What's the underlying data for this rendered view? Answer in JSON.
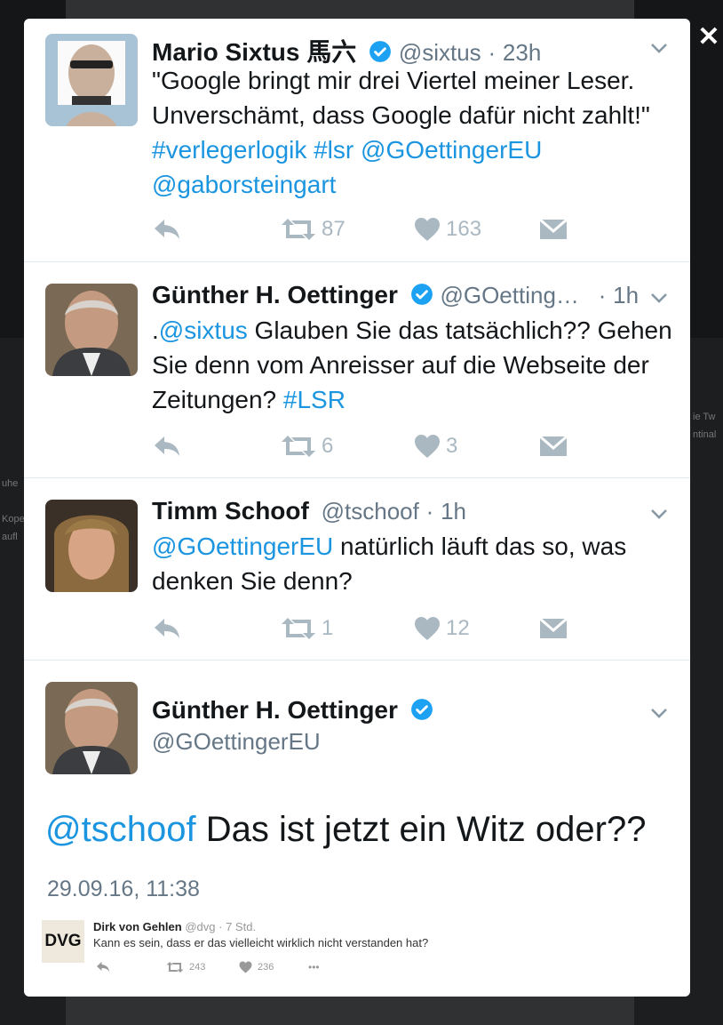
{
  "colors": {
    "link": "#1b95e0",
    "verified": "#1da1f2",
    "action": "#aab8c2",
    "overlay": "#1c1e20"
  },
  "close": {
    "icon": "close-icon",
    "glyph": "✕"
  },
  "background_fragments": [
    "uhe",
    "Kope",
    "aufl",
    "ie Tw",
    "ntinal"
  ],
  "tweets": [
    {
      "avatar": "portrait-mario-sixtus",
      "name": "Mario Sixtus 馬六",
      "handle": "@sixtus",
      "separator": "·",
      "time": "23h",
      "parts": [
        {
          "t": "\"Google bringt mir drei Viertel meiner Leser. Unverschämt, dass Google dafür nicht zahlt!\" ",
          "link": false
        },
        {
          "t": "#verlegerlogik",
          "link": true
        },
        {
          "t": " ",
          "link": false
        },
        {
          "t": "#lsr",
          "link": true
        },
        {
          "t": " ",
          "link": false
        },
        {
          "t": "@GOettingerEU",
          "link": true
        },
        {
          "t": " ",
          "link": false
        },
        {
          "t": "@gaborsteingart",
          "link": true
        }
      ],
      "retweets": "87",
      "likes": "163"
    },
    {
      "avatar": "portrait-guenther-oettinger",
      "name": "Günther H. Oettinger",
      "handle": "@GOetting…",
      "separator": "·",
      "time": "1h",
      "parts": [
        {
          "t": ".",
          "link": false
        },
        {
          "t": "@sixtus",
          "link": true
        },
        {
          "t": " Glauben Sie das tatsächlich?? Gehen Sie denn vom Anreisser auf die Webseite der Zeitungen? ",
          "link": false
        },
        {
          "t": "#LSR",
          "link": true
        }
      ],
      "retweets": "6",
      "likes": "3"
    },
    {
      "avatar": "portrait-timm-schoof",
      "name": "Timm Schoof",
      "handle": "@tschoof",
      "separator": "·",
      "time": "1h",
      "parts": [
        {
          "t": "@GOettingerEU",
          "link": true
        },
        {
          "t": " natürlich läuft das so, was denken Sie denn?",
          "link": false
        }
      ],
      "retweets": "1",
      "likes": "12"
    }
  ],
  "main_tweet": {
    "avatar": "portrait-guenther-oettinger",
    "name": "Günther H. Oettinger",
    "handle": "@GOettingerEU",
    "mention": "@tschoof",
    "text": " Das ist jetzt ein Witz oder??",
    "date": "29.09.16, 11:38"
  },
  "embedded_reply": {
    "logo": "DVG",
    "name": "Dirk von Gehlen",
    "handle": "@dvg",
    "separator": "·",
    "time": "7 Std.",
    "text": "Kann es sein, dass er das vielleicht wirklich nicht verstanden hat?",
    "retweets": "243",
    "likes": "236",
    "more": "•••"
  }
}
